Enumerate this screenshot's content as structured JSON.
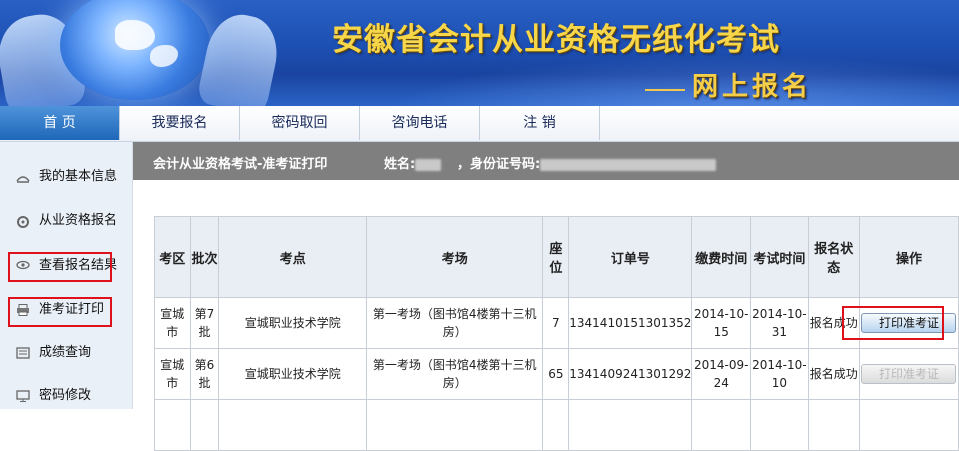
{
  "banner": {
    "title": "安徽省会计从业资格无纸化考试",
    "subtitle": "网上报名"
  },
  "nav": {
    "items": [
      "首 页",
      "我要报名",
      "密码取回",
      "咨询电话",
      "注 销"
    ]
  },
  "sidebar": {
    "items": [
      {
        "label": "我的基本信息",
        "icon": "user-info-icon"
      },
      {
        "label": "从业资格报名",
        "icon": "gear-icon"
      },
      {
        "label": "查看报名结果",
        "icon": "eye-icon"
      },
      {
        "label": "准考证打印",
        "icon": "printer-icon"
      },
      {
        "label": "成绩查询",
        "icon": "report-icon"
      },
      {
        "label": "密码修改",
        "icon": "monitor-icon"
      }
    ]
  },
  "content": {
    "header_title": "会计从业资格考试-准考证打印",
    "name_label": "姓名:",
    "id_label": "，身份证号码:"
  },
  "table": {
    "headers": [
      "考区",
      "批次",
      "考点",
      "考场",
      "座位",
      "订单号",
      "缴费时间",
      "考试时间",
      "报名状态",
      "操作"
    ],
    "rows": [
      {
        "area": "宣城市",
        "batch": "第7批",
        "site": "宣城职业技术学院",
        "room": "第一考场（图书馆4楼第十三机房）",
        "seat": "7",
        "order": "1341410151301352",
        "paid": "2014-10-15",
        "exam": "2014-10-31",
        "status": "报名成功",
        "action": "打印准考证",
        "enabled": true
      },
      {
        "area": "宣城市",
        "batch": "第6批",
        "site": "宣城职业技术学院",
        "room": "第一考场（图书馆4楼第十三机房）",
        "seat": "65",
        "order": "1341409241301292",
        "paid": "2014-09-24",
        "exam": "2014-10-10",
        "status": "报名成功",
        "action": "打印准考证",
        "enabled": false
      }
    ]
  },
  "colors": {
    "accent": "#1e67b9",
    "highlight": "#e0101a",
    "banner_text": "#f7d64a"
  }
}
